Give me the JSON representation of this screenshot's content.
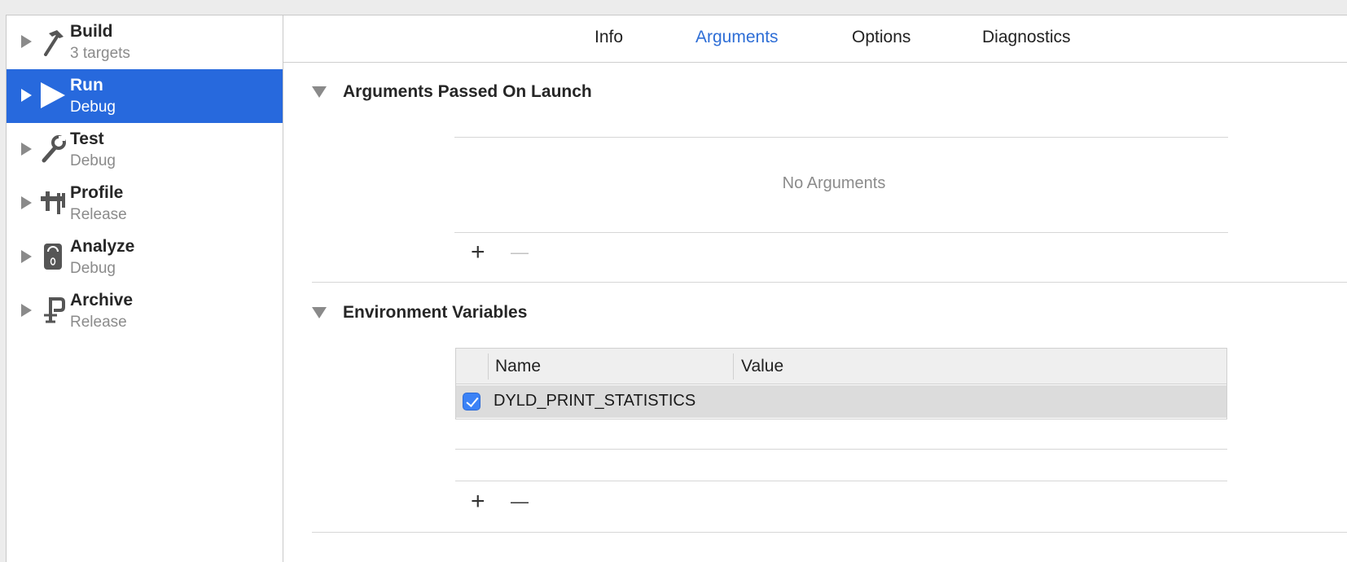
{
  "sidebar": {
    "items": [
      {
        "title": "Build",
        "subtitle": "3 targets",
        "icon": "hammer-icon"
      },
      {
        "title": "Run",
        "subtitle": "Debug",
        "icon": "play-icon",
        "selected": true
      },
      {
        "title": "Test",
        "subtitle": "Debug",
        "icon": "wrench-icon"
      },
      {
        "title": "Profile",
        "subtitle": "Release",
        "icon": "caliper-icon"
      },
      {
        "title": "Analyze",
        "subtitle": "Debug",
        "icon": "meter-icon"
      },
      {
        "title": "Archive",
        "subtitle": "Release",
        "icon": "clamp-icon"
      }
    ]
  },
  "tabs": [
    {
      "label": "Info"
    },
    {
      "label": "Arguments",
      "active": true
    },
    {
      "label": "Options"
    },
    {
      "label": "Diagnostics"
    }
  ],
  "arguments_section": {
    "title": "Arguments Passed On Launch",
    "empty_text": "No Arguments",
    "add_label": "+",
    "remove_label": "—"
  },
  "env_section": {
    "title": "Environment Variables",
    "columns": {
      "name": "Name",
      "value": "Value"
    },
    "rows": [
      {
        "checked": true,
        "name": "DYLD_PRINT_STATISTICS",
        "value": ""
      }
    ],
    "add_label": "+",
    "remove_label": "—"
  },
  "colors": {
    "accent": "#2e6ed6",
    "selection": "#2769dd",
    "checkbox": "#3b82f6"
  }
}
